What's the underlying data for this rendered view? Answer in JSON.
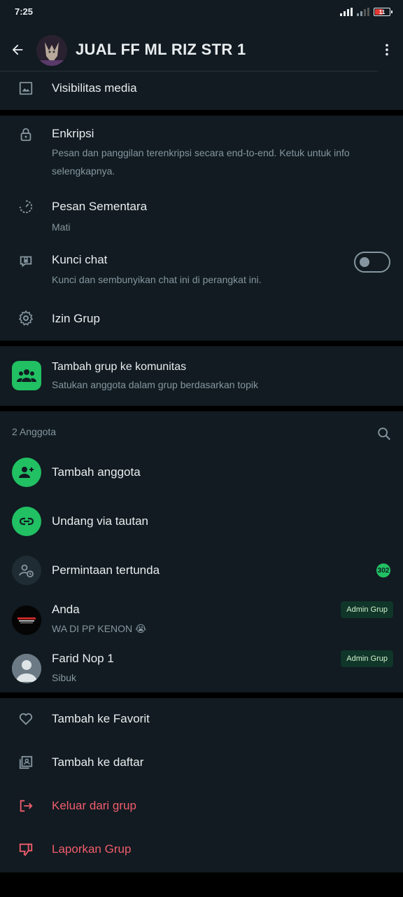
{
  "status": {
    "time": "7:25",
    "battery": "11"
  },
  "header": {
    "title": "JUAL FF ML RIZ STR 1"
  },
  "media": {
    "label": "Visibilitas media"
  },
  "settings": [
    {
      "title": "Enkripsi",
      "subtitle": "Pesan dan panggilan terenkripsi secara end-to-end. Ketuk untuk info selengkapnya.",
      "icon": "lock-icon"
    },
    {
      "title": "Pesan Sementara",
      "subtitle": "Mati",
      "icon": "timer-icon"
    },
    {
      "title": "Kunci chat",
      "subtitle": "Kunci dan sembunyikan chat ini di perangkat ini.",
      "icon": "chat-lock-icon",
      "toggle": "off"
    },
    {
      "title": "Izin Grup",
      "icon": "gear-icon"
    }
  ],
  "community": {
    "title": "Tambah grup ke komunitas",
    "subtitle": "Satukan anggota dalam grup berdasarkan topik"
  },
  "members": {
    "count_label": "2 Anggota",
    "actions": [
      {
        "label": "Tambah anggota"
      },
      {
        "label": "Undang via tautan"
      },
      {
        "label": "Permintaan tertunda",
        "badge": "302"
      }
    ],
    "list": [
      {
        "name": "Anda",
        "status": "WA DI PP KENON 😭",
        "badge": "Admin Grup"
      },
      {
        "name": "Farid Nop 1",
        "status": "Sibuk",
        "badge": "Admin Grup"
      }
    ]
  },
  "footer_actions": [
    {
      "label": "Tambah ke Favorit"
    },
    {
      "label": "Tambah ke daftar"
    },
    {
      "label": "Keluar dari grup"
    },
    {
      "label": "Laporkan Grup"
    }
  ],
  "colors": {
    "background": "#111b21",
    "accent": "#21c063",
    "danger": "#f15c6d",
    "secondary_text": "#8696a0"
  }
}
